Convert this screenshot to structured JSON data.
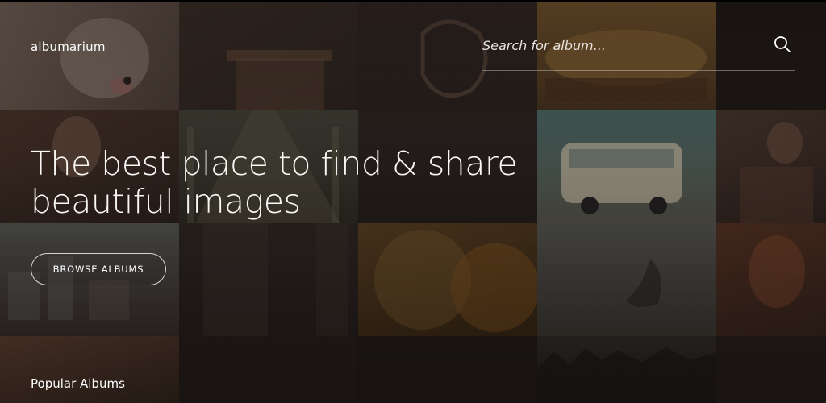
{
  "brand": "albumarium",
  "search": {
    "placeholder": "Search for album..."
  },
  "hero": {
    "title_line1": "The best place to find & share",
    "title_line2": "beautiful images",
    "browse_label": "BROWSE ALBUMS"
  },
  "popular_heading": "Popular Albums",
  "icons": {
    "search": "search-icon"
  },
  "colors": {
    "background": "#1a1513",
    "text": "#ffffff"
  },
  "tiles": [
    {
      "name": "tile-white-dog",
      "color": "#6b5a52"
    },
    {
      "name": "tile-chair",
      "color": "#3a2e29"
    },
    {
      "name": "tile-ornament",
      "color": "#2d2421"
    },
    {
      "name": "tile-sandwich",
      "color": "#6a4a2a"
    },
    {
      "name": "tile-dark",
      "color": "#1f1917"
    },
    {
      "name": "tile-woman",
      "color": "#3a2b24"
    },
    {
      "name": "tile-garden-path",
      "color": "#3c3a2c"
    },
    {
      "name": "tile-fence",
      "color": "#2a2321"
    },
    {
      "name": "tile-vw-bus",
      "color": "#5b5e58"
    },
    {
      "name": "tile-man-reading",
      "color": "#3d2c27"
    },
    {
      "name": "tile-city",
      "color": "#44484a"
    },
    {
      "name": "tile-building",
      "color": "#2b2522"
    },
    {
      "name": "tile-lion-tiger",
      "color": "#5a3f21"
    },
    {
      "name": "tile-pelican",
      "color": "#4b4a45"
    },
    {
      "name": "tile-redhead",
      "color": "#4a2e25"
    },
    {
      "name": "tile-corgi",
      "color": "#5d4436"
    },
    {
      "name": "tile-dark-2",
      "color": "#252020"
    },
    {
      "name": "tile-dark-3",
      "color": "#221c1b"
    },
    {
      "name": "tile-trees",
      "color": "#2d2a28"
    },
    {
      "name": "tile-dark-4",
      "color": "#2a2220"
    }
  ]
}
